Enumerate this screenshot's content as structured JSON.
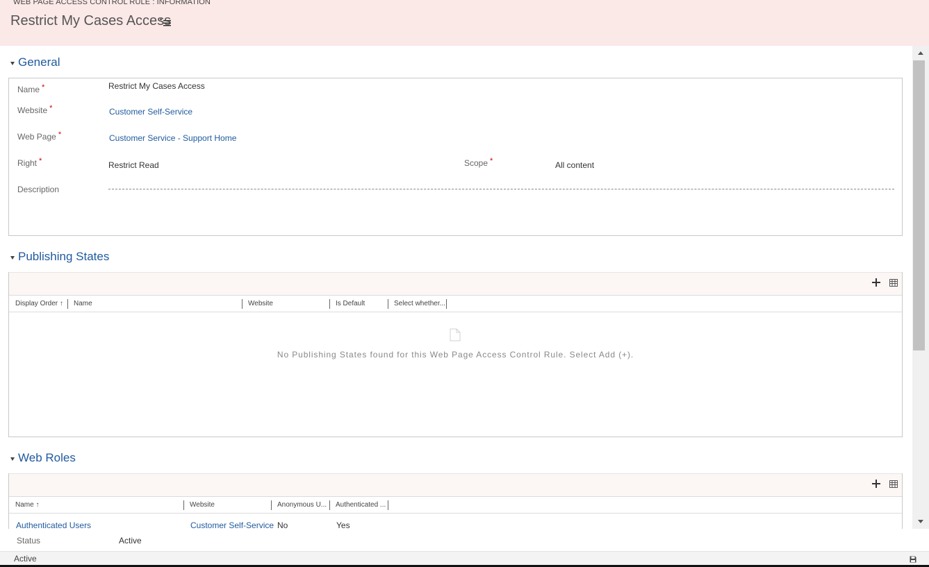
{
  "header": {
    "entity_type": "WEB PAGE ACCESS CONTROL RULE : INFORMATION",
    "title": "Restrict My Cases Access",
    "menu_icon": "hamburger-menu-icon"
  },
  "general": {
    "section_title": "General",
    "required_mark": "*",
    "name": {
      "label": "Name",
      "value": "Restrict My Cases Access"
    },
    "website": {
      "label": "Website",
      "value": "Customer Self-Service"
    },
    "web_page": {
      "label": "Web Page",
      "value": "Customer Service - Support Home"
    },
    "right": {
      "label": "Right",
      "value": "Restrict Read"
    },
    "scope": {
      "label": "Scope",
      "value": "All content"
    },
    "description": {
      "label": "Description",
      "value": ""
    }
  },
  "publishing_states": {
    "section_title": "Publishing States",
    "add_icon": "plus-icon",
    "grid_icon": "grid-view-icon",
    "columns": [
      "Display Order",
      "Name",
      "Website",
      "Is Default",
      "Select whether..."
    ],
    "sort_arrow": "↑",
    "empty_icon": "document-icon",
    "empty_message": "No Publishing States found for this Web Page Access Control Rule. Select Add (+)."
  },
  "web_roles": {
    "section_title": "Web Roles",
    "add_icon": "plus-icon",
    "grid_icon": "grid-view-icon",
    "columns": [
      "Name",
      "Website",
      "Anonymous U...",
      "Authenticated ..."
    ],
    "sort_arrow": "↑",
    "rows": [
      {
        "name": "Authenticated Users",
        "website": "Customer Self-Service",
        "anonymous": "No",
        "authenticated": "Yes"
      }
    ]
  },
  "status_field": {
    "label": "Status",
    "value": "Active"
  },
  "footer": {
    "status": "Active",
    "save_icon": "save-icon"
  },
  "colors": {
    "header_bg": "#fbe9e7",
    "link": "#1f5a9e",
    "required": "#cc0000",
    "toolbar_bg": "#fcf7f5"
  }
}
